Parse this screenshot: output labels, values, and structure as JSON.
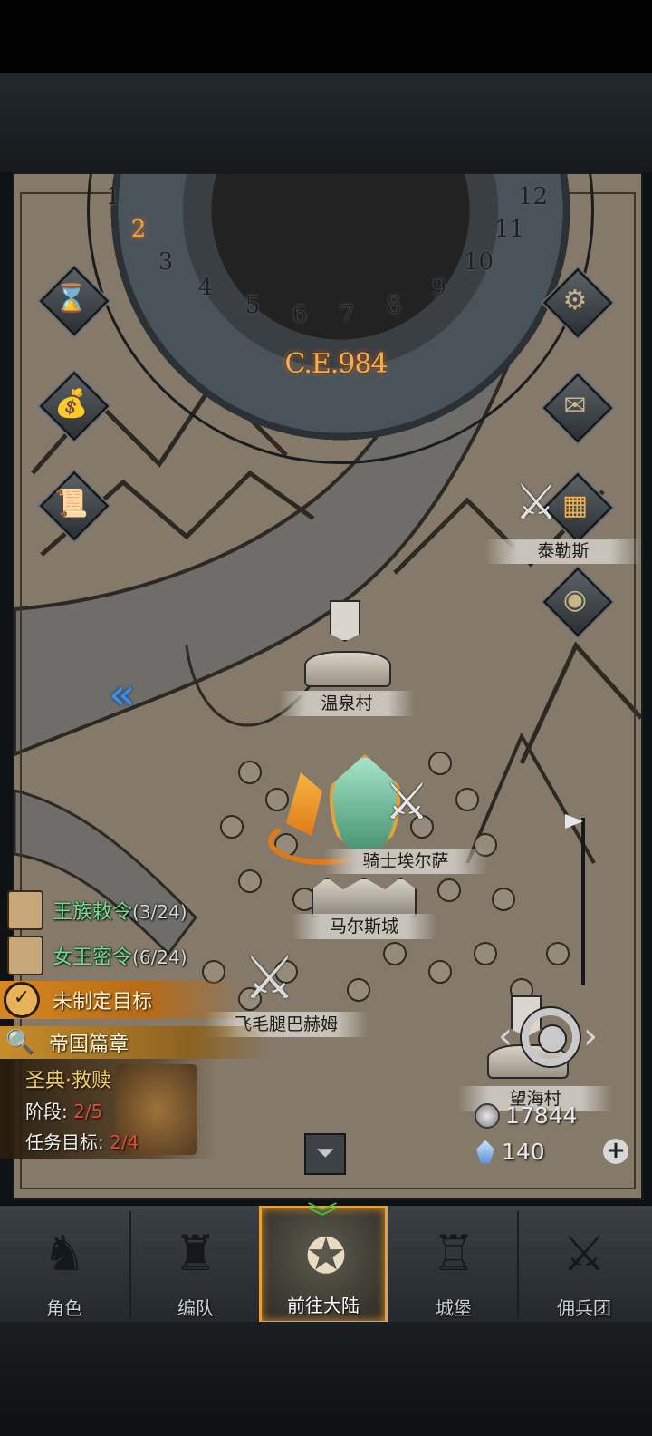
{
  "calendar": {
    "year": "C.E.984",
    "months": [
      "1",
      "2",
      "3",
      "4",
      "5",
      "6",
      "7",
      "8",
      "9",
      "10",
      "11",
      "12"
    ],
    "current_month": "2"
  },
  "map": {
    "locations": {
      "hot_spring_village": "温泉村",
      "taylors": "泰勒斯",
      "mars_city": "马尔斯城",
      "knight_label": "骑士埃尔萨",
      "hairy_leg": "飞毛腿巴赫姆",
      "sea_view_village": "望海村"
    }
  },
  "quests": {
    "royal_decree": {
      "label": "王族敕令",
      "count": "(3/24)"
    },
    "queen_order": {
      "label": "女王密令",
      "count": "(6/24)"
    },
    "goal": "未制定目标",
    "chapter": {
      "title": "帝国篇章",
      "subtitle": "圣典·救赎",
      "stage_label": "阶段:",
      "stage_value": "2/5",
      "target_label": "任务目标:",
      "target_value": "2/4"
    }
  },
  "currency": {
    "silver": "17844",
    "crystal": "140"
  },
  "nav": {
    "tabs": [
      "角色",
      "编队",
      "前往大陆",
      "城堡",
      "佣兵团"
    ],
    "active": "前往大陆"
  },
  "colors": {
    "accent": "#e3a23a",
    "quest_green": "#6ee08f",
    "progress_red": "#e04a3a"
  }
}
